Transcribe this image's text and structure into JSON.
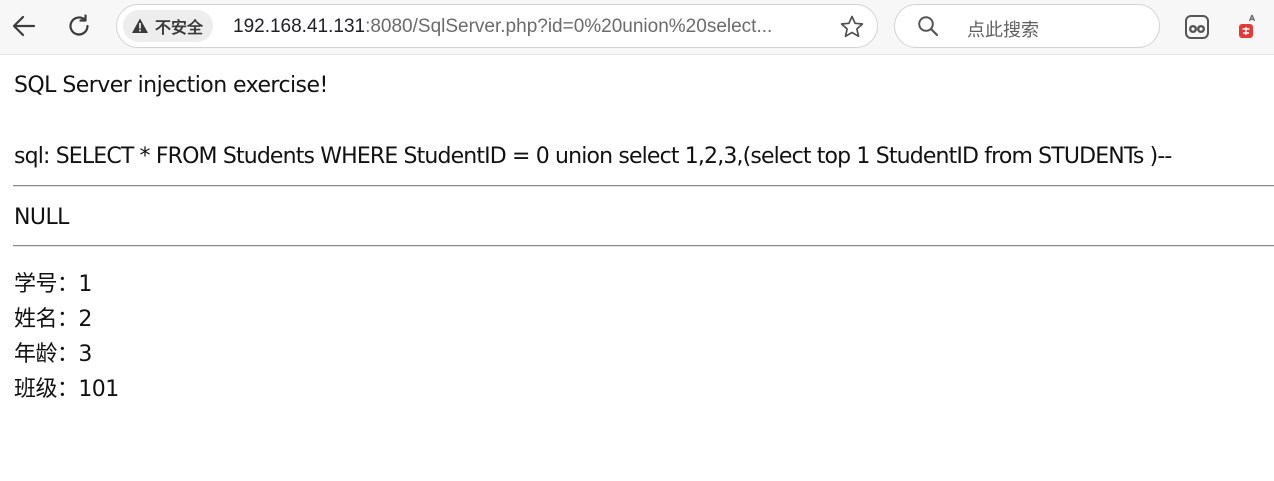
{
  "browser": {
    "security_label": "不安全",
    "url_host": "192.168.41.131",
    "url_rest": ":8080/SqlServer.php?id=0%20union%20select...",
    "search_placeholder": "点此搜索",
    "icons": {
      "back": "arrow-left-icon",
      "reload": "reload-icon",
      "security": "warning-triangle-icon",
      "bookmark": "star-outline-icon",
      "search": "magnifier-icon",
      "extension1": "extension-grid-icon",
      "extension2": "translate-extension-icon"
    }
  },
  "page": {
    "title": "SQL Server injection exercise!",
    "sql_line": "sql: SELECT * FROM Students WHERE StudentID = 0 union select 1,2,3,(select top 1 StudentID from STUDENTs )--",
    "null_line": "NULL",
    "fields": [
      {
        "label": "学号：",
        "value": "1"
      },
      {
        "label": "姓名：",
        "value": "2"
      },
      {
        "label": "年龄：",
        "value": "3"
      },
      {
        "label": "班级：",
        "value": "101"
      }
    ]
  },
  "colors": {
    "toolbar_bg": "#f7f7f7",
    "chip_bg": "#ededed",
    "extension_red": "#e53935"
  }
}
